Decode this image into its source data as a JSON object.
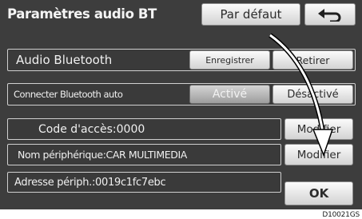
{
  "header": {
    "title": "Paramètres audio BT",
    "default_label": "Par défaut",
    "back_icon": "return-arrow-icon"
  },
  "rows": {
    "bt_audio": {
      "label": "Audio Bluetooth",
      "register_label": "Enregistrer",
      "remove_label": "Retirer"
    },
    "auto_connect": {
      "label": "Connecter Bluetooth auto",
      "on_label": "Activé",
      "off_label": "Désactivé"
    },
    "passkey": {
      "label": "Code d'accès:0000",
      "modify_label": "Modifier"
    },
    "device_name": {
      "label": "Nom périphérique:CAR MULTIMEDIA",
      "modify_label": "Modifier"
    },
    "address": {
      "label": "Adresse périph.:0019c1fc7ebc"
    }
  },
  "ok_label": "OK",
  "image_code": "D10021GS",
  "colors": {
    "screen_bg": "#3d3d3d",
    "button": "#e8e8e8",
    "selected_button": "#b4b4b4"
  }
}
